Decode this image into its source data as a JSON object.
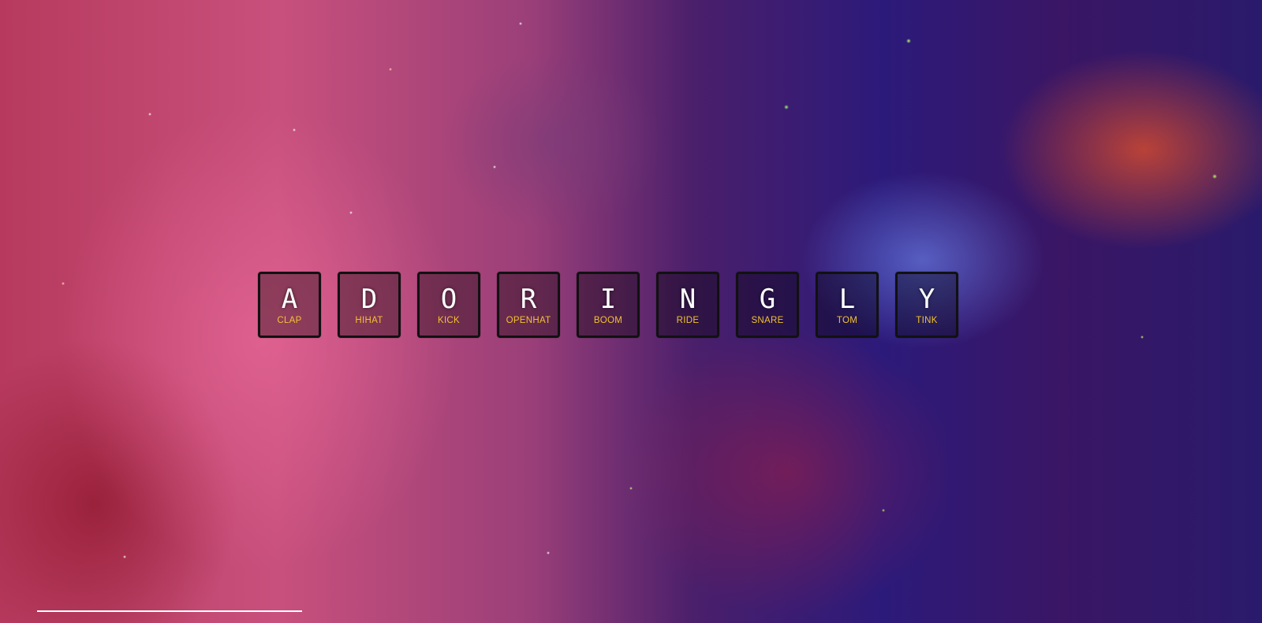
{
  "keys": [
    {
      "letter": "A",
      "sound": "CLAP"
    },
    {
      "letter": "D",
      "sound": "HIHAT"
    },
    {
      "letter": "O",
      "sound": "KICK"
    },
    {
      "letter": "R",
      "sound": "OPENHAT"
    },
    {
      "letter": "I",
      "sound": "BOOM"
    },
    {
      "letter": "N",
      "sound": "RIDE"
    },
    {
      "letter": "G",
      "sound": "SNARE"
    },
    {
      "letter": "L",
      "sound": "TOM"
    },
    {
      "letter": "Y",
      "sound": "TINK"
    }
  ],
  "colors": {
    "key_letter": "#ffffff",
    "key_sound": "#f2c230",
    "key_border": "#111111"
  }
}
